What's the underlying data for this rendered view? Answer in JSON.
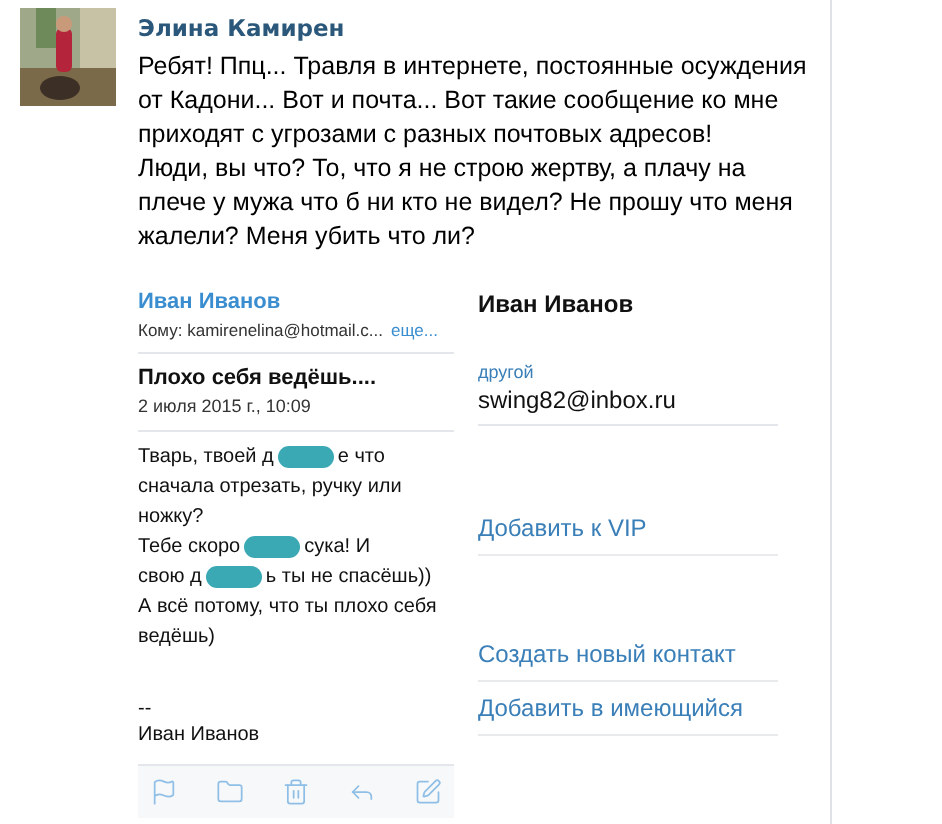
{
  "post": {
    "author": "Элина Камирен",
    "paragraphs": [
      "Ребят! Ппц... Травля в интернете, постоянные осуждения от Кадони... Вот и почта... Вот такие сообщение ко мне приходят с угрозами с разных почтовых адресов!",
      "Люди, вы что? То, что я не строю жертву, а плачу на плече у мужа что б ни кто не видел? Не прошу что меня жалели? Меня убить что ли?"
    ]
  },
  "email": {
    "sender": "Иван Иванов",
    "to": "Кому: kamirenelina@hotmail.c...",
    "more": "еще...",
    "subject": "Плохо себя ведёшь....",
    "date": "2 июля 2015 г., 10:09",
    "body": [
      {
        "parts": [
          "Тварь, твоей д",
          "е что"
        ]
      },
      {
        "parts": [
          "сначала отрезать, ручку или"
        ]
      },
      {
        "parts": [
          "ножку?"
        ]
      },
      {
        "parts": [
          "Тебе скоро ",
          "сука! И"
        ]
      },
      {
        "parts": [
          "свою д",
          "ь ты не спасёшь))"
        ]
      },
      {
        "parts": [
          "А всё потому, что ты плохо себя"
        ]
      },
      {
        "parts": [
          "ведёшь)"
        ]
      }
    ],
    "signature": [
      "--",
      "Иван Иванов"
    ],
    "toolbar": [
      {
        "kind": "flag"
      },
      {
        "kind": "folder"
      },
      {
        "kind": "trash"
      },
      {
        "kind": "reply"
      },
      {
        "kind": "compose"
      }
    ]
  },
  "contact": {
    "name": "Иван Иванов",
    "email_label": "другой",
    "email": "swing82@inbox.ru",
    "actions": [
      "Добавить к VIP",
      "Создать новый контакт",
      "Добавить в имеющийся"
    ]
  }
}
